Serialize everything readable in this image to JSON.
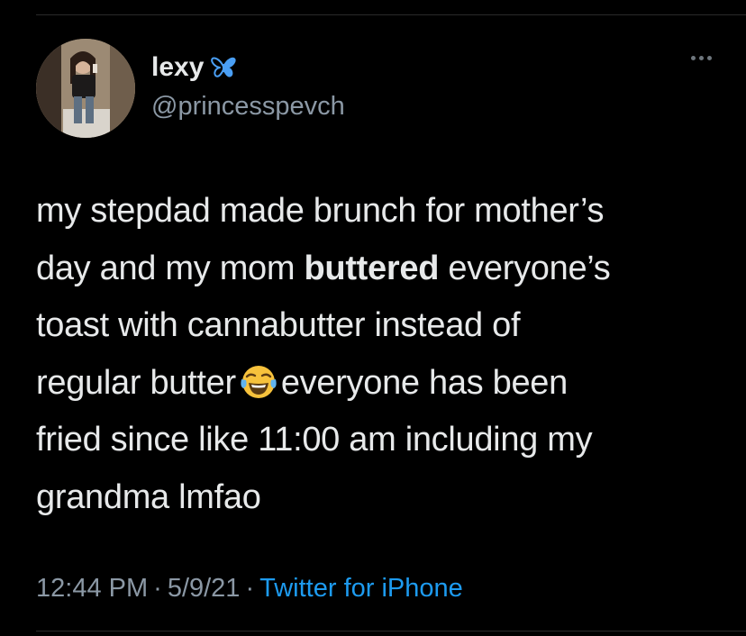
{
  "tweet": {
    "author": {
      "display_name": "lexy",
      "badge_icon": "butterfly-icon",
      "handle": "@princesspevch"
    },
    "more_icon": "ellipsis-icon",
    "text": {
      "line1": "my stepdad made brunch for mother’s",
      "line2_pre": "day and my mom ",
      "line2_bold": "buttered",
      "line2_post": " everyone’s",
      "line3": "toast with cannabutter instead of",
      "line4_pre": "regular butter",
      "emoji": "face-with-tears-of-joy-emoji",
      "line4_post": "everyone has been",
      "line5": "fried since like 11:00 am including my",
      "line6": "grandma lmfao"
    },
    "meta": {
      "time": "12:44 PM",
      "separator": "·",
      "date": "5/9/21",
      "source": "Twitter for iPhone"
    }
  },
  "colors": {
    "background": "#000000",
    "text": "#e7e9ea",
    "secondary": "#8b98a5",
    "accent": "#1d9bf0",
    "butterfly": "#4a9ff5"
  }
}
